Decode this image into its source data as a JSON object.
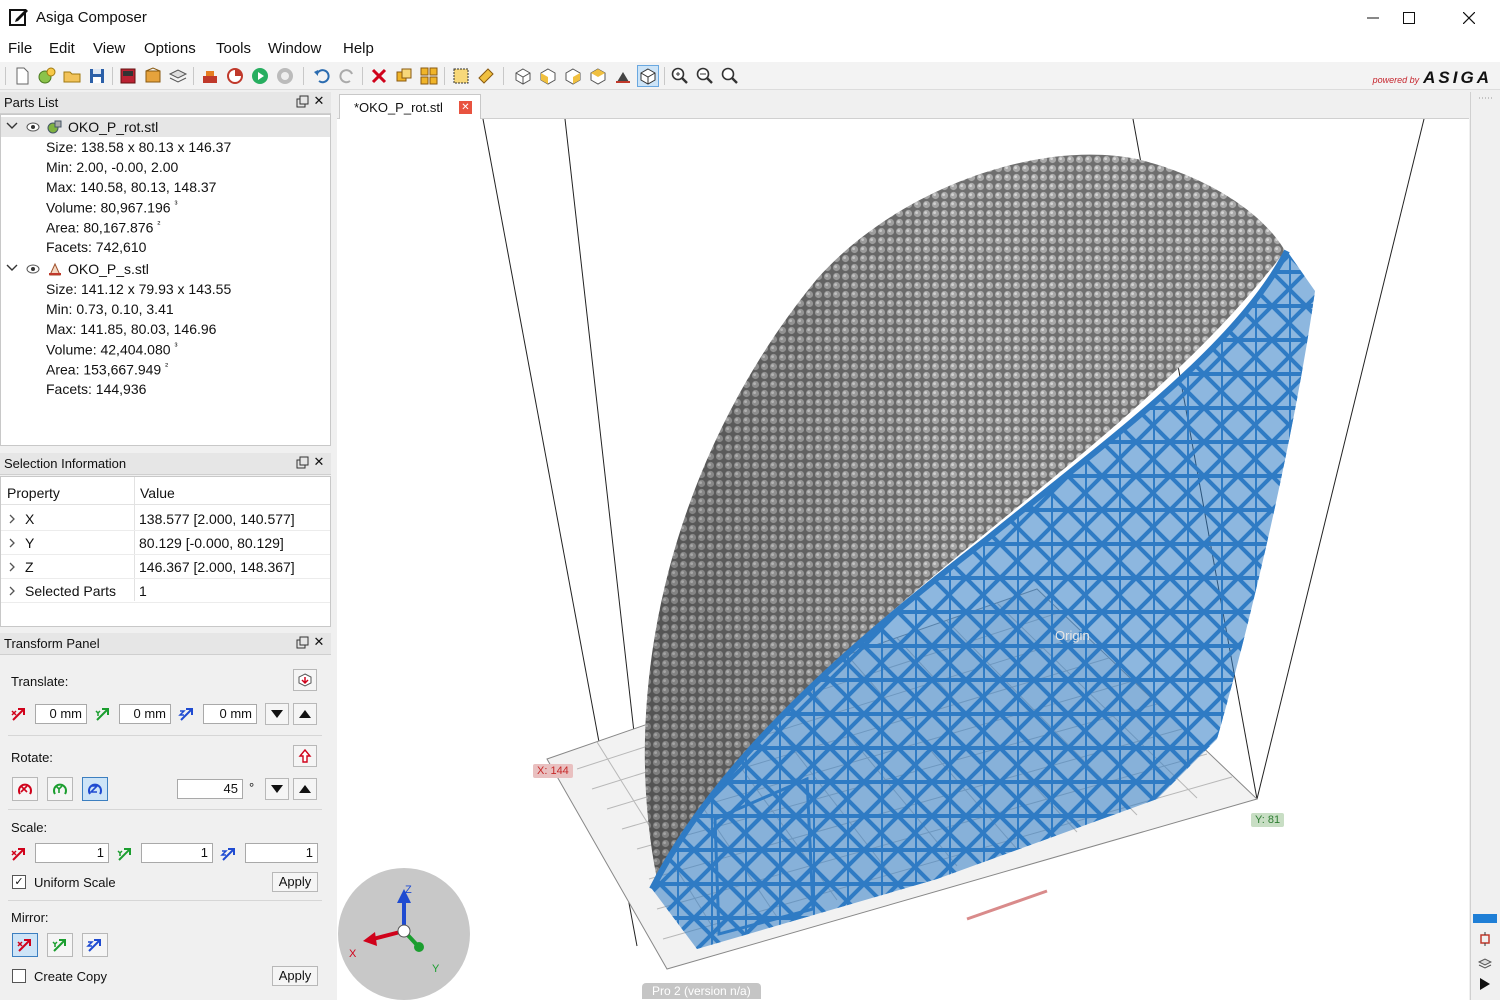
{
  "window": {
    "title": "Asiga Composer"
  },
  "menu": [
    "File",
    "Edit",
    "View",
    "Options",
    "Tools",
    "Window",
    "Help"
  ],
  "brand": {
    "powered_by": "powered by",
    "name": "ASIGA"
  },
  "parts_list": {
    "title": "Parts List",
    "parts": [
      {
        "name": "OKO_P_rot.stl",
        "size": "Size: 138.58 x 80.13 x 146.37",
        "min": "Min: 2.00, -0.00, 2.00",
        "max": "Max: 140.58, 80.13, 148.37",
        "volume": "Volume: 80,967.196",
        "area": "Area: 80,167.876",
        "facets": "Facets: 742,610"
      },
      {
        "name": "OKO_P_s.stl",
        "size": "Size: 141.12 x 79.93 x 143.55",
        "min": "Min: 0.73, 0.10, 3.41",
        "max": "Max: 141.85, 80.03, 146.96",
        "volume": "Volume: 42,404.080",
        "area": "Area: 153,667.949",
        "facets": "Facets: 144,936"
      }
    ],
    "volume_unit": "³",
    "area_unit": "²"
  },
  "selection_info": {
    "title": "Selection Information",
    "col_property": "Property",
    "col_value": "Value",
    "rows": [
      {
        "name": "X",
        "value": "138.577 [2.000, 140.577]"
      },
      {
        "name": "Y",
        "value": "80.129 [-0.000, 80.129]"
      },
      {
        "name": "Z",
        "value": "146.367 [2.000, 148.367]"
      },
      {
        "name": "Selected Parts",
        "value": "1"
      }
    ]
  },
  "transform": {
    "title": "Transform Panel",
    "translate_label": "Translate:",
    "translate": [
      "0 mm",
      "0 mm",
      "0 mm"
    ],
    "rotate_label": "Rotate:",
    "rotate_angle": "45",
    "degree": "°",
    "scale_label": "Scale:",
    "scale": [
      "1",
      "1",
      "1"
    ],
    "uniform_scale": "Uniform Scale",
    "uniform_checked": true,
    "mirror_label": "Mirror:",
    "create_copy": "Create Copy",
    "create_copy_checked": false,
    "apply": "Apply"
  },
  "viewport": {
    "tab_label": "*OKO_P_rot.stl",
    "x_tag": "X: 144",
    "y_tag": "Y: 81",
    "origin_label": "Origin",
    "status": "Pro 2 (version n/a)",
    "gizmo": {
      "x": "X",
      "y": "Y",
      "z": "Z"
    }
  },
  "colors": {
    "support_blue": "#2f7bc4",
    "part_gray": "#8a8a8a",
    "accent": "#3c7fc0"
  }
}
